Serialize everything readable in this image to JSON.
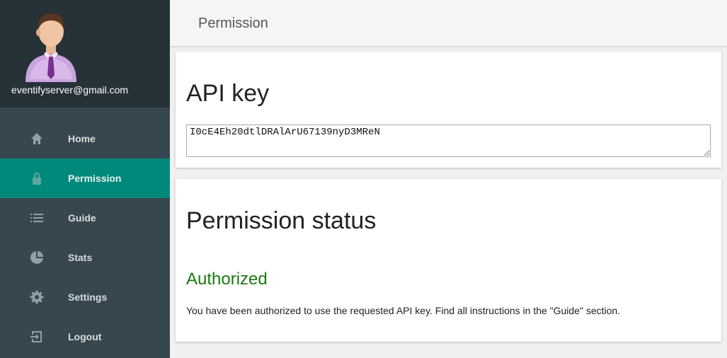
{
  "user": {
    "email": "eventifyserver@gmail.com"
  },
  "sidebar": {
    "items": [
      {
        "label": "Home",
        "icon": "home-icon"
      },
      {
        "label": "Permission",
        "icon": "lock-icon",
        "active": true
      },
      {
        "label": "Guide",
        "icon": "list-icon"
      },
      {
        "label": "Stats",
        "icon": "pie-chart-icon"
      },
      {
        "label": "Settings",
        "icon": "gear-icon"
      },
      {
        "label": "Logout",
        "icon": "logout-icon"
      }
    ]
  },
  "header": {
    "title": "Permission"
  },
  "api_card": {
    "title": "API key",
    "key_value": "I0cE4Eh20dtlDRAlArU67139nyD3MReN"
  },
  "status_card": {
    "title": "Permission status",
    "status": "Authorized",
    "description": "You have been authorized to use the requested API key. Find all instructions in the \"Guide\" section."
  },
  "colors": {
    "sidebar_bg": "#37474f",
    "profile_bg": "#263238",
    "accent": "#00897b",
    "status_green": "#1b7a10"
  }
}
